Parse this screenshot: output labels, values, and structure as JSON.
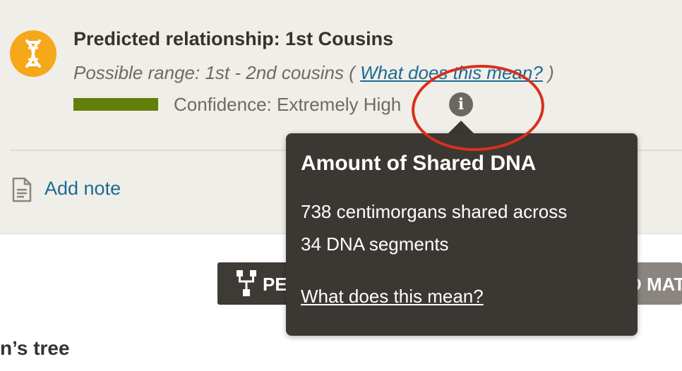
{
  "relationship": {
    "title": "Predicted relationship: 1st Cousins",
    "range_prefix": "Possible range: 1st - 2nd cousins (",
    "range_link": "What does this mean?",
    "range_suffix": ")",
    "confidence": "Confidence: Extremely High",
    "confidence_color": "#627f0a",
    "badge_color": "#f6a81b",
    "badge_icon": "dna-icon",
    "info_icon": "info-icon",
    "info_glyph": "i"
  },
  "note": {
    "icon": "document-icon",
    "label": "Add note"
  },
  "buttons": {
    "tree_label": "PE",
    "tree_icon": "pedigree-icon",
    "match_label": "D MAT"
  },
  "tree_heading": "n’s tree",
  "tooltip": {
    "title": "Amount of Shared DNA",
    "line1": "738 centimorgans shared across",
    "line2": "34 DNA segments",
    "link": "What does this mean?"
  },
  "annotation": {
    "color": "#d9301c"
  }
}
